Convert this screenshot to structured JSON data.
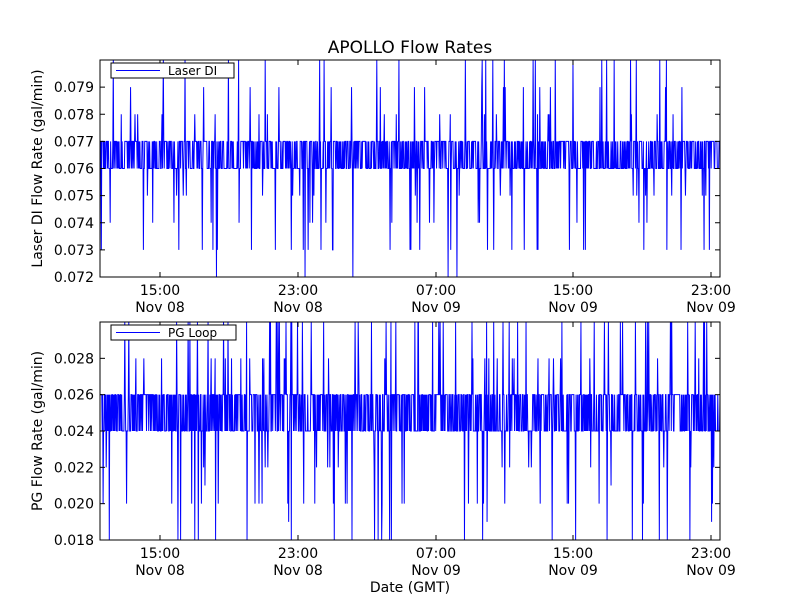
{
  "chart_data": [
    {
      "type": "line",
      "title": "APOLLO Flow Rates",
      "xlabel": "",
      "ylabel": "Laser DI Flow Rate (gal/min)",
      "ylim": [
        0.072,
        0.08
      ],
      "yticks": [
        "0.072",
        "0.073",
        "0.074",
        "0.075",
        "0.076",
        "0.077",
        "0.078",
        "0.079"
      ],
      "xlim": [
        "Nov 08 11:30",
        "Nov 10 00:30"
      ],
      "xticks": [
        {
          "time": "15:00",
          "date": "Nov 08"
        },
        {
          "time": "23:00",
          "date": "Nov 08"
        },
        {
          "time": "07:00",
          "date": "Nov 09"
        },
        {
          "time": "15:00",
          "date": "Nov 09"
        },
        {
          "time": "23:00",
          "date": "Nov 09"
        }
      ],
      "legend_loc": "upper left",
      "series": [
        {
          "name": "Laser DI",
          "color": "#0000ff",
          "baseline": 0.0765,
          "band": [
            0.076,
            0.077
          ],
          "outliers_high": 0.08,
          "outliers_low": 0.072
        }
      ]
    },
    {
      "type": "line",
      "title": "",
      "xlabel": "Date (GMT)",
      "ylabel": "PG Flow Rate (gal/min)",
      "ylim": [
        0.018,
        0.03
      ],
      "yticks": [
        "0.018",
        "0.020",
        "0.022",
        "0.024",
        "0.026",
        "0.028"
      ],
      "xlim": [
        "Nov 08 11:30",
        "Nov 10 00:30"
      ],
      "xticks": [
        {
          "time": "15:00",
          "date": "Nov 08"
        },
        {
          "time": "23:00",
          "date": "Nov 08"
        },
        {
          "time": "07:00",
          "date": "Nov 09"
        },
        {
          "time": "15:00",
          "date": "Nov 09"
        },
        {
          "time": "23:00",
          "date": "Nov 09"
        }
      ],
      "legend_loc": "upper left",
      "series": [
        {
          "name": "PG Loop",
          "color": "#0000ff",
          "baseline": 0.025,
          "band": [
            0.024,
            0.026
          ],
          "outliers_high": 0.03,
          "outliers_low": 0.019
        }
      ]
    }
  ]
}
